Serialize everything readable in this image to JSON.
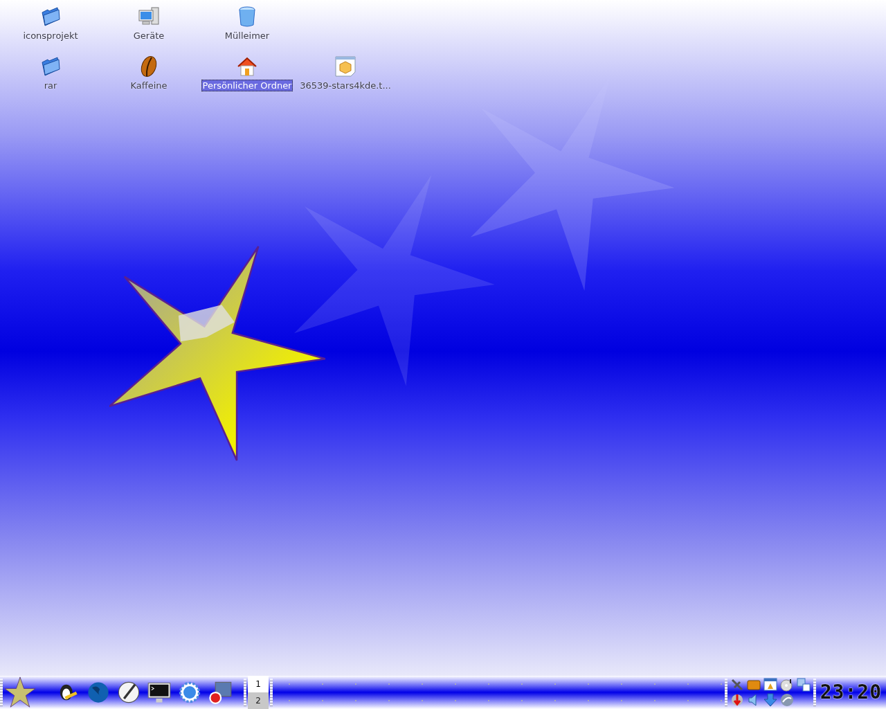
{
  "desktop_rows": [
    [
      {
        "label": "iconsprojekt",
        "kind": "folder",
        "selected": false
      },
      {
        "label": "Geräte",
        "kind": "computer",
        "selected": false
      },
      {
        "label": "Mülleimer",
        "kind": "trash",
        "selected": false
      }
    ],
    [
      {
        "label": "rar",
        "kind": "folder",
        "selected": false
      },
      {
        "label": "Kaffeine",
        "kind": "bean",
        "selected": false
      },
      {
        "label": "Persönlicher Ordner",
        "kind": "home",
        "selected": true
      },
      {
        "label": "36539-stars4kde.t...",
        "kind": "package",
        "selected": false
      }
    ]
  ],
  "pager": [
    {
      "label": "1",
      "selected": true
    },
    {
      "label": "2",
      "selected": false
    }
  ],
  "clock": "23:20"
}
